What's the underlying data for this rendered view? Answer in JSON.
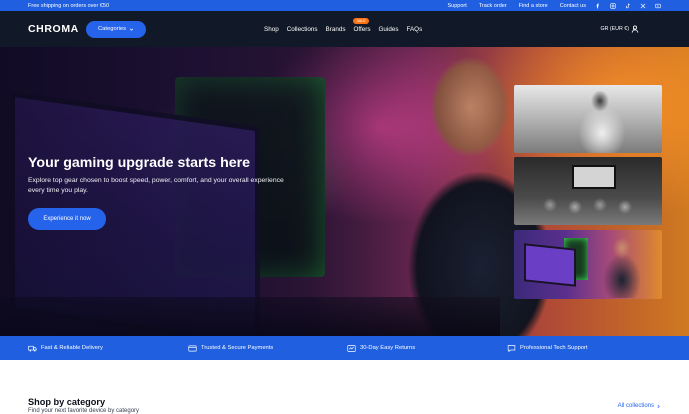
{
  "topbar": {
    "promo": "Free shipping on orders over €50",
    "links": [
      "Support",
      "Track order",
      "Find a store",
      "Contact us"
    ],
    "social_icons": [
      "facebook-icon",
      "instagram-icon",
      "tiktok-icon",
      "x-icon",
      "youtube-icon"
    ]
  },
  "nav": {
    "logo": "CHROMA",
    "categories_label": "Categories",
    "menu": [
      "Shop",
      "Collections",
      "Brands",
      "Offers",
      "Guides",
      "FAQs"
    ],
    "offers_badge": "SALE",
    "locale": "GR (EUR €)"
  },
  "hero": {
    "title": "Your gaming upgrade starts here",
    "subtitle": "Explore top gear chosen to boost speed, power, comfort, and your overall experience every time you play.",
    "cta": "Experience it now"
  },
  "features": [
    {
      "label": "Fast & Reliable Delivery",
      "icon": "truck-icon"
    },
    {
      "label": "Trusted & Secure Payments",
      "icon": "card-icon"
    },
    {
      "label": "30-Day Easy Returns",
      "icon": "return-icon"
    },
    {
      "label": "Professional Tech Support",
      "icon": "chat-icon"
    }
  ],
  "shop": {
    "title": "Shop by category",
    "subtitle": "Find your next favorite device by category",
    "all_link": "All collections"
  },
  "colors": {
    "brand_blue": "#2563eb",
    "topbar_blue": "#1f5fe0",
    "nav_dark": "#111827",
    "badge_orange": "#f97316"
  }
}
